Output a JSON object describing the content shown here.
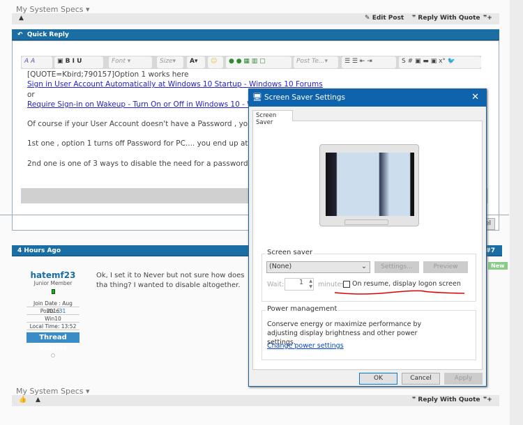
{
  "top": {
    "specs": "My System Specs",
    "edit_post": "Edit Post",
    "reply_with_quote": "Reply With Quote"
  },
  "quick_reply": {
    "title": "Quick Reply",
    "toolbar": {
      "font": "Font",
      "size": "Size",
      "post_template": "Post Te..."
    },
    "lines": [
      "[QUOTE=Kbird;790157]Option 1 works here",
      "Sign in User Account Automatically at Windows 10 Startup - Windows 10 Forums",
      "or",
      "Require Sign-in on Wakeup - Turn On or Off in Windows 10 - Windo",
      "Of course if your User Account doesn't have a Password , you can't c",
      "1st one , option 1 turns off Password for PC....  you end up at the De",
      "2nd one is one of 3 ways to disable the need for a password after th"
    ],
    "cancel_partial": "el"
  },
  "post": {
    "time": "4 Hours Ago",
    "number": "#7",
    "new_badge": "New",
    "username": "hatemf23",
    "rank": "Junior Member",
    "join_date": "Join Date : Aug 2016",
    "posts_label": "Posts : ",
    "posts": "31",
    "os": "Win10",
    "local_time": "Local Time: 13:52",
    "thread_starter": "Thread Starter",
    "body": "Ok, I set it to Never but not sure how does tha thing? I wanted to disable altogether.",
    "specs": "My System Specs",
    "reply_with_quote": "Reply With Quote"
  },
  "dialog": {
    "title": "Screen Saver Settings",
    "tab": "Screen Saver",
    "screen_saver_group": "Screen saver",
    "selected": "(None)",
    "settings_btn": "Settings...",
    "preview_btn": "Preview",
    "wait_label": "Wait:",
    "wait_value": "1",
    "minutes": "minutes",
    "logon_checkbox": "On resume, display logon screen",
    "logon_checked": false,
    "power_group": "Power management",
    "power_text": "Conserve energy or maximize performance by adjusting display brightness and other power settings.",
    "power_link": "Change power settings",
    "ok": "OK",
    "cancel": "Cancel",
    "apply": "Apply",
    "annotation_color": "#e00000"
  }
}
